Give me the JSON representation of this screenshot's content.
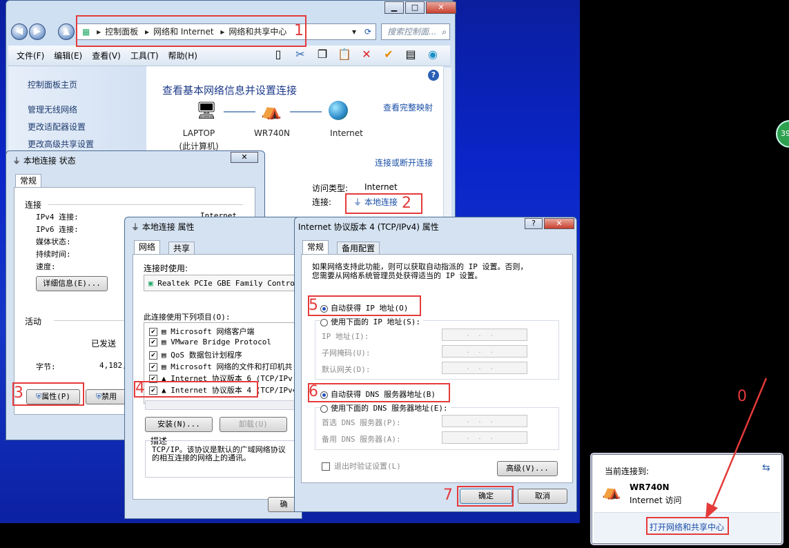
{
  "main_window": {
    "breadcrumb": [
      "控制面板",
      "网络和 Internet",
      "网络和共享中心"
    ],
    "search_placeholder": "搜索控制面...",
    "menu": [
      "文件(F)",
      "编辑(E)",
      "查看(V)",
      "工具(T)",
      "帮助(H)"
    ],
    "sidebar": [
      "控制面板主页",
      "管理无线网络",
      "更改适配器设置",
      "更改高级共享设置"
    ],
    "heading": "查看基本网络信息并设置连接",
    "full_map_link": "查看完整映射",
    "nodes": [
      {
        "name": "LAPTOP",
        "sub": "(此计算机)"
      },
      {
        "name": "WR740N",
        "sub": ""
      },
      {
        "name": "Internet",
        "sub": ""
      }
    ],
    "connect_link": "连接或断开连接",
    "access_type_label": "访问类型:",
    "access_type_value": "Internet",
    "connection_label": "连接:",
    "connection_value": "本地连接"
  },
  "status_dialog": {
    "title": "本地连接 状态",
    "tab": "常规",
    "connection_heading": "连接",
    "rows": [
      "IPv4 连接:",
      "IPv6 连接:",
      "媒体状态:",
      "持续时间:",
      "速度:"
    ],
    "ipv4_value": "Internet",
    "details_button": "详细信息(E)...",
    "activity_heading": "活动",
    "sent_label": "已发送",
    "bytes_label": "字节:",
    "bytes_value": "4,182,",
    "properties_button": "属性(P)",
    "disable_button": "禁用"
  },
  "props_dialog": {
    "title": "本地连接 属性",
    "tabs": [
      "网络",
      "共享"
    ],
    "connect_using_label": "连接时使用:",
    "adapter": "Realtek PCIe GBE Family Control",
    "items_label": "此连接使用下列项目(O):",
    "items": [
      "Microsoft 网络客户端",
      "VMware Bridge Protocol",
      "QoS 数据包计划程序",
      "Microsoft 网络的文件和打印机共",
      "Internet 协议版本 6 (TCP/IPv",
      "Internet 协议版本 4 (TCP/IPv4"
    ],
    "install_button": "安装(N)...",
    "uninstall_button": "卸载(U)",
    "desc_label": "描述",
    "desc_text": "TCP/IP。该协议是默认的广域网络协议\n的相互连接的网络上的通讯。",
    "ok_button": "确"
  },
  "ipv4_dialog": {
    "title": "Internet 协议版本 4 (TCP/IPv4) 属性",
    "tabs": [
      "常规",
      "备用配置"
    ],
    "intro": "如果网络支持此功能，则可以获取自动指派的 IP 设置。否则，\n您需要从网络系统管理员处获得适当的 IP 设置。",
    "auto_ip": "自动获得 IP 地址(O)",
    "manual_ip": "使用下面的 IP 地址(S):",
    "ip_fields": [
      "IP 地址(I):",
      "子网掩码(U):",
      "默认网关(D):"
    ],
    "auto_dns": "自动获得 DNS 服务器地址(B)",
    "manual_dns": "使用下面的 DNS 服务器地址(E):",
    "dns_fields": [
      "首选 DNS 服务器(P):",
      "备用 DNS 服务器(A):"
    ],
    "validate": "退出时验证设置(L)",
    "advanced_button": "高级(V)...",
    "ok_button": "确定",
    "cancel_button": "取消"
  },
  "tray_popup": {
    "heading": "当前连接到:",
    "network_name": "WR740N",
    "network_status": "Internet 访问",
    "open_center_link": "打开网络和共享中心"
  },
  "annotations": [
    "1",
    "2",
    "3",
    "4",
    "5",
    "6",
    "7",
    "0"
  ],
  "side_badge": "39",
  "colors": {
    "annotation_red": "#e43a3a",
    "link_blue": "#1a4fa6"
  }
}
